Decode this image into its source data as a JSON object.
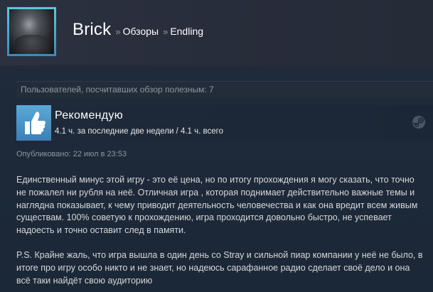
{
  "header": {
    "username": "Brick",
    "separator": "»",
    "crumb_reviews": "Обзоры",
    "crumb_game": "Endling"
  },
  "helpful": {
    "text": "Пользователей, посчитавших обзор полезным: 7"
  },
  "recommendation": {
    "title": "Рекомендую",
    "hours": "4.1 ч. за последние две недели / 4.1 ч. всего",
    "thumb_icon": "thumbs-up-icon",
    "platform_icon": "steam-icon"
  },
  "posted": {
    "text": "Опубликовано: 22 июл в 23:53"
  },
  "review": {
    "paragraphs": [
      "Единственный минус этой игру - это её цена, но по итогу прохождения я могу сказать, что точно не пожалел ни рубля на неё. Отличная игра , которая поднимает действительно важные темы и наглядна показывает, к чему приводит деятельность человечества и как она вредит всем живым существам. 100% советую к прохождению, игра проходится довольно быстро, не успевает надоесть и точно оставит след в памяти.",
      "P.S. Крайне жаль, что игра вышла в один день со Stray и сильной пиар компании у неё не было, в итоге про игру особо никто и не знает, но надеюсь сарафанное радио сделает своё дело и она всё таки найдёт свою аудиторию"
    ]
  },
  "colors": {
    "background": "#1b2838",
    "avatar_border": "#57cbde",
    "thumb_bg": "#4b95c8",
    "muted_text": "#8f98a0"
  }
}
